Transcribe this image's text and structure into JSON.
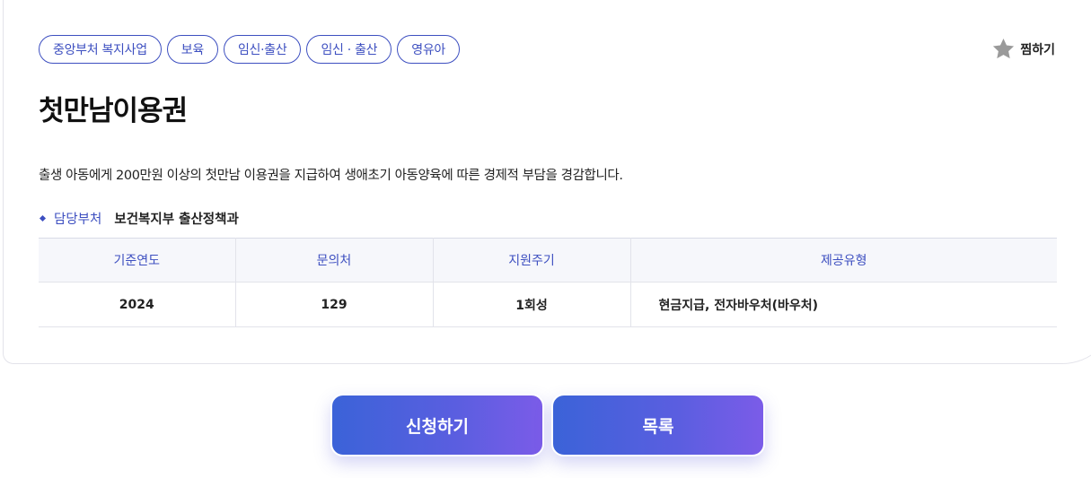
{
  "tags": [
    "중앙부처 복지사업",
    "보육",
    "임신·출산",
    "임신 · 출산",
    "영유아"
  ],
  "favorite": {
    "label": "찜하기",
    "icon": "star-icon",
    "color": "#9a9a9a"
  },
  "title": "첫만남이용권",
  "description": "출생 아동에게 200만원 이상의 첫만남 이용권을 지급하여 생애초기 아동양육에 따른 경제적 부담을 경감합니다.",
  "department": {
    "label": "담당부처",
    "value": "보건복지부 출산정책과"
  },
  "table": {
    "headers": [
      "기준연도",
      "문의처",
      "지원주기",
      "제공유형"
    ],
    "rows": [
      [
        "2024",
        "129",
        "1회성",
        "현금지급, 전자바우처(바우처)"
      ]
    ]
  },
  "buttons": {
    "apply_label": "신청하기",
    "list_label": "목록"
  },
  "colors": {
    "accent": "#3d4fc0",
    "button_start": "#3b63d8",
    "button_end": "#7b5ce8"
  }
}
